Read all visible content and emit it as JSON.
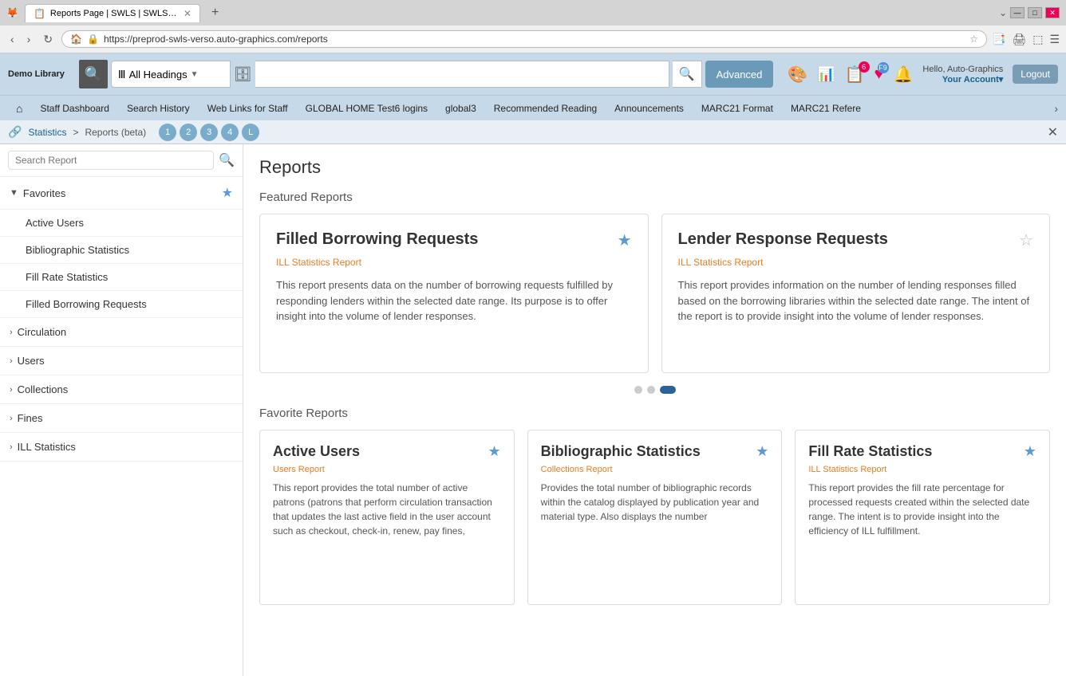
{
  "browser": {
    "tab_title": "Reports Page | SWLS | SWLS | A...",
    "tab_favicon": "🦊",
    "close_btn": "✕",
    "url": "https://preprod-swls-verso.auto-graphics.com/reports",
    "window_controls": [
      "—",
      "□",
      "✕"
    ],
    "new_tab_plus": "+",
    "tab_down": "⌄"
  },
  "header": {
    "library_name": "Demo Library",
    "search_heading": "All Headings",
    "search_placeholder": "",
    "advanced_label": "Advanced",
    "badge_count": "6",
    "badge_label": "F9",
    "greeting": "Hello, Auto-Graphics",
    "account_label": "Your Account▾",
    "logout_label": "Logout"
  },
  "nav": {
    "home_icon": "⌂",
    "items": [
      "Staff Dashboard",
      "Search History",
      "Web Links for Staff",
      "GLOBAL HOME Test6 logins",
      "global3",
      "Recommended Reading",
      "Announcements",
      "MARC21 Format",
      "MARC21 Refere"
    ],
    "more_icon": "›"
  },
  "breadcrumb": {
    "icon": "🔗",
    "link": "Statistics",
    "separator": ">",
    "current": "Reports (beta)",
    "pages": [
      "1",
      "2",
      "3",
      "4",
      "L"
    ],
    "close_icon": "✕"
  },
  "sidebar": {
    "search_placeholder": "Search Report",
    "search_icon": "🔍",
    "favorites_label": "Favorites",
    "favorites_star": "★",
    "favorite_items": [
      "Active Users",
      "Bibliographic Statistics",
      "Fill Rate Statistics",
      "Filled Borrowing Requests"
    ],
    "groups": [
      {
        "label": "Circulation"
      },
      {
        "label": "Users"
      },
      {
        "label": "Collections"
      },
      {
        "label": "Fines"
      },
      {
        "label": "ILL Statistics"
      }
    ]
  },
  "content": {
    "page_title": "Reports",
    "featured_section_title": "Featured Reports",
    "featured_cards": [
      {
        "title": "Filled Borrowing Requests",
        "category": "ILL Statistics Report",
        "description": "This report presents data on the number of borrowing requests fulfilled by responding lenders within the selected date range. Its purpose is to offer insight into the volume of lender responses.",
        "star_filled": true
      },
      {
        "title": "Lender Response Requests",
        "category": "ILL Statistics Report",
        "description": "This report provides information on the number of lending responses filled based on the borrowing libraries within the selected date range. The intent of the report is to provide insight into the volume of lender responses.",
        "star_filled": false
      }
    ],
    "carousel_dots": [
      "",
      "",
      "active"
    ],
    "favorite_section_title": "Favorite Reports",
    "favorite_cards": [
      {
        "title": "Active Users",
        "category": "Users Report",
        "description": "This report provides the total number of active patrons (patrons that perform circulation transaction that updates the last active field in the user account such as checkout, check-in, renew, pay fines,",
        "star_filled": true
      },
      {
        "title": "Bibliographic Statistics",
        "category": "Collections Report",
        "description": "Provides the total number of bibliographic records within the catalog displayed by publication year and material type. Also displays the number",
        "star_filled": true
      },
      {
        "title": "Fill Rate Statistics",
        "category": "ILL Statistics Report",
        "description": "This report provides the fill rate percentage for processed requests created within the selected date range. The intent is to provide insight into the efficiency of ILL fulfillment.",
        "star_filled": true
      }
    ]
  }
}
